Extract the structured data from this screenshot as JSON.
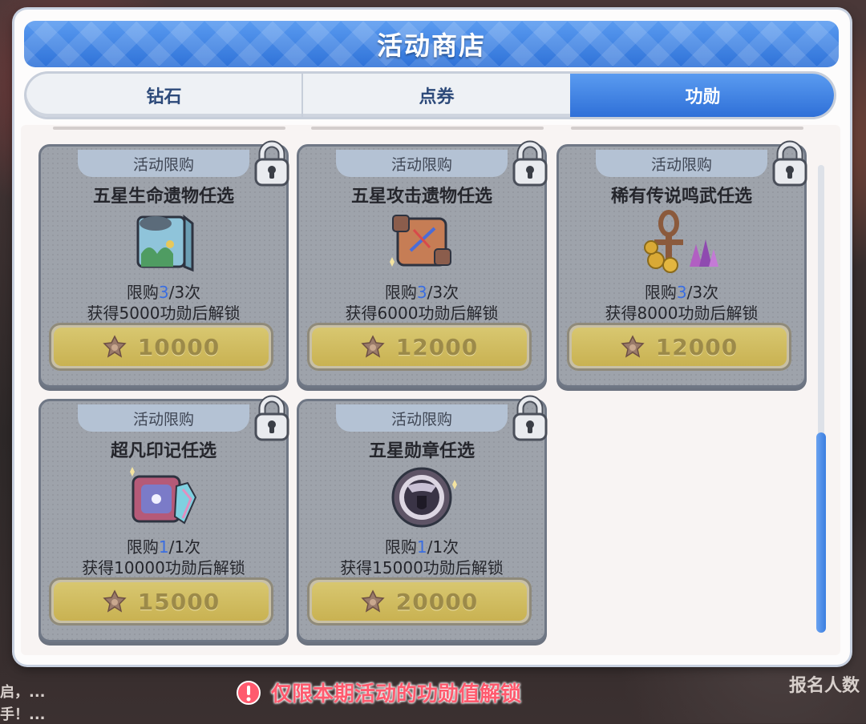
{
  "background": {
    "right_text": "报名人数",
    "left_line1": "启，...",
    "left_line2": "手！..."
  },
  "dialog": {
    "title": "活动商店",
    "tabs": [
      {
        "label": "钻石",
        "active": false
      },
      {
        "label": "点券",
        "active": false
      },
      {
        "label": "功勋",
        "active": true
      }
    ]
  },
  "items": [
    {
      "tag": "活动限购",
      "name": "五星生命遗物任选",
      "limit_prefix": "限购",
      "limit_current": "3",
      "limit_rest": "/3次",
      "unlock": "获得5000功勋后解锁",
      "price": "10000",
      "locked": true,
      "icon": "life-relic-chest-icon"
    },
    {
      "tag": "活动限购",
      "name": "五星攻击遗物任选",
      "limit_prefix": "限购",
      "limit_current": "3",
      "limit_rest": "/3次",
      "unlock": "获得6000功勋后解锁",
      "price": "12000",
      "locked": true,
      "icon": "attack-relic-chest-icon"
    },
    {
      "tag": "活动限购",
      "name": "稀有传说鸣武任选",
      "limit_prefix": "限购",
      "limit_current": "3",
      "limit_rest": "/3次",
      "unlock": "获得8000功勋后解锁",
      "price": "12000",
      "locked": true,
      "icon": "legendary-weapon-icon"
    },
    {
      "tag": "活动限购",
      "name": "超凡印记任选",
      "limit_prefix": "限购",
      "limit_current": "1",
      "limit_rest": "/1次",
      "unlock": "获得10000功勋后解锁",
      "price": "15000",
      "locked": true,
      "icon": "mark-chest-icon"
    },
    {
      "tag": "活动限购",
      "name": "五星勋章任选",
      "limit_prefix": "限购",
      "limit_current": "1",
      "limit_rest": "/1次",
      "unlock": "获得15000功勋后解锁",
      "price": "20000",
      "locked": true,
      "icon": "medal-icon"
    }
  ],
  "notice": {
    "text": "仅限本期活动的功勋值解锁"
  },
  "colors": {
    "accent_blue": "#2f72d8",
    "card_gray": "#9ea3ab",
    "price_gold": "#c9b252",
    "notice_red": "#ff5a6e"
  }
}
